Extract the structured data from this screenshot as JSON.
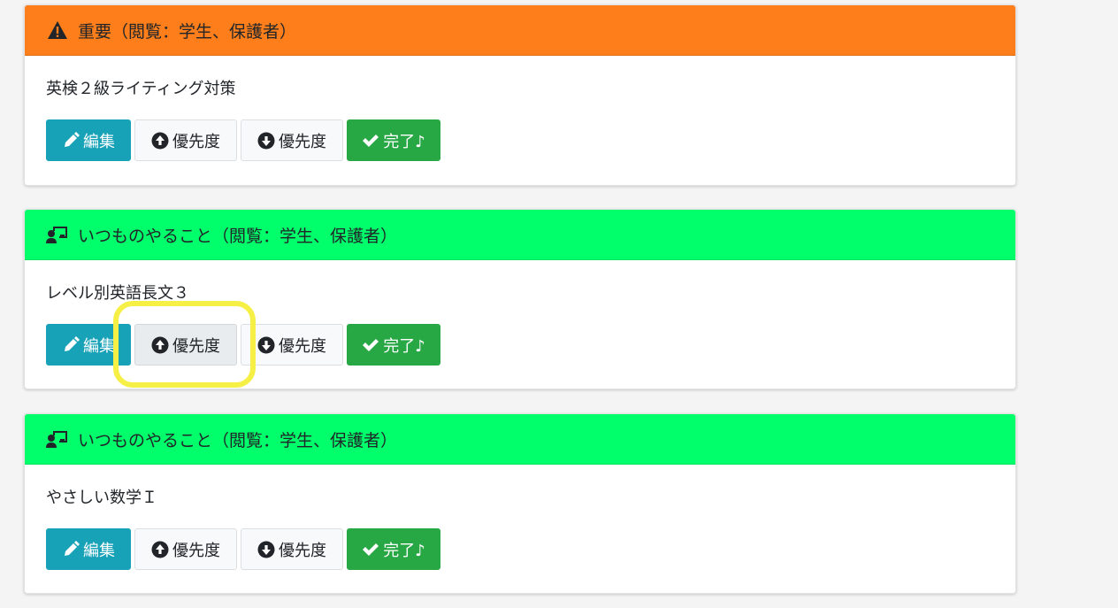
{
  "colors": {
    "important_header": "#fd7e1a",
    "routine_header": "#00ff6a",
    "edit_button": "#17a2b8",
    "done_button": "#28a745",
    "highlight": "#f6ef45"
  },
  "cards": [
    {
      "header_icon": "warning-triangle-icon",
      "header_title": "重要（閲覧：学生、保護者）",
      "task_title": "英検２級ライティング対策",
      "buttons": {
        "edit": "編集",
        "priority_up": "優先度",
        "priority_down": "優先度",
        "done": "完了♪"
      }
    },
    {
      "header_icon": "chalkboard-teacher-icon",
      "header_title": "いつものやること（閲覧：学生、保護者）",
      "task_title": "レベル別英語長文３",
      "buttons": {
        "edit": "編集",
        "priority_up": "優先度",
        "priority_down": "優先度",
        "done": "完了♪"
      }
    },
    {
      "header_icon": "chalkboard-teacher-icon",
      "header_title": "いつものやること（閲覧：学生、保護者）",
      "task_title": "やさしい数学Ｉ",
      "buttons": {
        "edit": "編集",
        "priority_up": "優先度",
        "priority_down": "優先度",
        "done": "完了♪"
      }
    }
  ]
}
